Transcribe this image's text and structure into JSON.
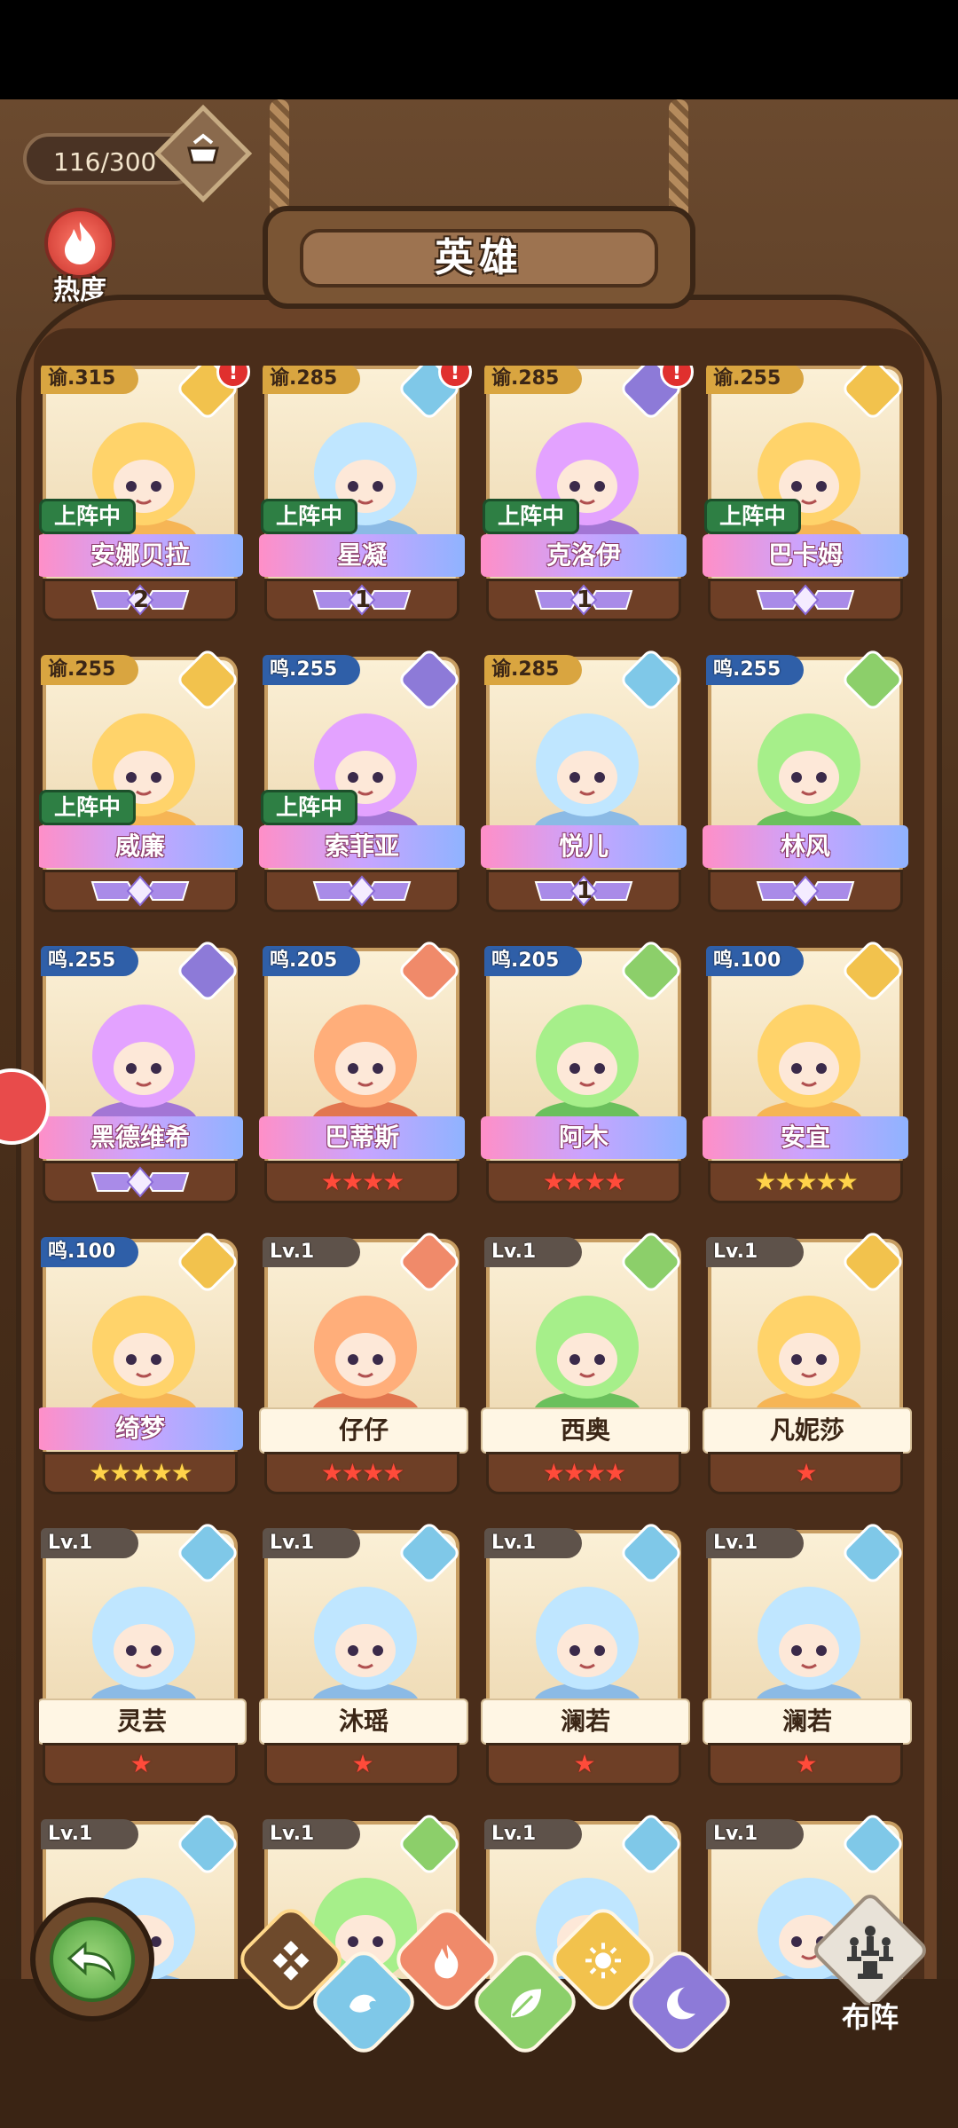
{
  "header": {
    "hero_count": "116/300",
    "heat_label": "热度",
    "title": "英雄"
  },
  "colors": {
    "light": "#f2c24d",
    "water": "#7fc8e8",
    "dark": "#8d7ad8",
    "nature": "#8ccf6a",
    "fire": "#f08a6a",
    "deploy_green": "#2e7f44"
  },
  "heroes": [
    {
      "level": "谕.315",
      "element": "light",
      "alert": "!",
      "deployed": "上阵中",
      "name": "安娜贝拉",
      "rank": "2",
      "rank_type": "wing"
    },
    {
      "level": "谕.285",
      "element": "water",
      "alert": "!",
      "deployed": "上阵中",
      "name": "星凝",
      "rank": "1",
      "rank_type": "wing"
    },
    {
      "level": "谕.285",
      "element": "dark",
      "alert": "!",
      "deployed": "上阵中",
      "name": "克洛伊",
      "rank": "1",
      "rank_type": "wing"
    },
    {
      "level": "谕.255",
      "element": "light",
      "alert": "",
      "deployed": "上阵中",
      "name": "巴卡姆",
      "rank": "",
      "rank_type": "wing"
    },
    {
      "level": "谕.255",
      "element": "light",
      "alert": "",
      "deployed": "上阵中",
      "name": "威廉",
      "rank": "",
      "rank_type": "wing"
    },
    {
      "level": "鸣.255",
      "element": "dark",
      "alert": "",
      "deployed": "上阵中",
      "name": "索菲亚",
      "rank": "",
      "rank_type": "wing"
    },
    {
      "level": "谕.285",
      "element": "water",
      "alert": "",
      "deployed": "",
      "name": "悦儿",
      "rank": "1",
      "rank_type": "wing"
    },
    {
      "level": "鸣.255",
      "element": "nature",
      "alert": "",
      "deployed": "",
      "name": "林风",
      "rank": "",
      "rank_type": "wing"
    },
    {
      "level": "鸣.255",
      "element": "dark",
      "alert": "",
      "deployed": "",
      "name": "黑德维希",
      "rank": "",
      "rank_type": "wing"
    },
    {
      "level": "鸣.205",
      "element": "fire",
      "alert": "",
      "deployed": "",
      "name": "巴蒂斯",
      "stars": 4,
      "star_color": "red"
    },
    {
      "level": "鸣.205",
      "element": "nature",
      "alert": "",
      "deployed": "",
      "name": "阿木",
      "stars": 4,
      "star_color": "red"
    },
    {
      "level": "鸣.100",
      "element": "light",
      "alert": "",
      "deployed": "",
      "name": "安宜",
      "stars": 5,
      "star_color": "gold"
    },
    {
      "level": "鸣.100",
      "element": "light",
      "alert": "",
      "deployed": "",
      "name": "绮梦",
      "stars": 5,
      "star_color": "gold"
    },
    {
      "level": "Lv.1",
      "element": "fire",
      "alert": "",
      "deployed": "",
      "name": "仔仔",
      "stars": 4,
      "star_color": "red"
    },
    {
      "level": "Lv.1",
      "element": "nature",
      "alert": "",
      "deployed": "",
      "name": "西奥",
      "stars": 4,
      "star_color": "red"
    },
    {
      "level": "Lv.1",
      "element": "light",
      "alert": "",
      "deployed": "",
      "name": "凡妮莎",
      "stars": 1,
      "star_color": "red"
    },
    {
      "level": "Lv.1",
      "element": "water",
      "alert": "",
      "deployed": "",
      "name": "灵芸",
      "stars": 1,
      "star_color": "red"
    },
    {
      "level": "Lv.1",
      "element": "water",
      "alert": "",
      "deployed": "",
      "name": "沐瑶",
      "stars": 1,
      "star_color": "red"
    },
    {
      "level": "Lv.1",
      "element": "water",
      "alert": "",
      "deployed": "",
      "name": "澜若",
      "stars": 1,
      "star_color": "red"
    },
    {
      "level": "Lv.1",
      "element": "water",
      "alert": "",
      "deployed": "",
      "name": "澜若",
      "stars": 1,
      "star_color": "red"
    },
    {
      "level": "Lv.1",
      "element": "water",
      "alert": "",
      "deployed": "",
      "name": "",
      "stars": 0
    },
    {
      "level": "Lv.1",
      "element": "nature",
      "alert": "",
      "deployed": "",
      "name": "",
      "stars": 0
    },
    {
      "level": "Lv.1",
      "element": "water",
      "alert": "",
      "deployed": "",
      "name": "",
      "stars": 0
    },
    {
      "level": "Lv.1",
      "element": "water",
      "alert": "",
      "deployed": "",
      "name": "",
      "stars": 0
    }
  ],
  "bottom_bar": {
    "filters": [
      "all",
      "water",
      "fire",
      "nature",
      "light",
      "dark"
    ],
    "formation_label": "布阵"
  }
}
